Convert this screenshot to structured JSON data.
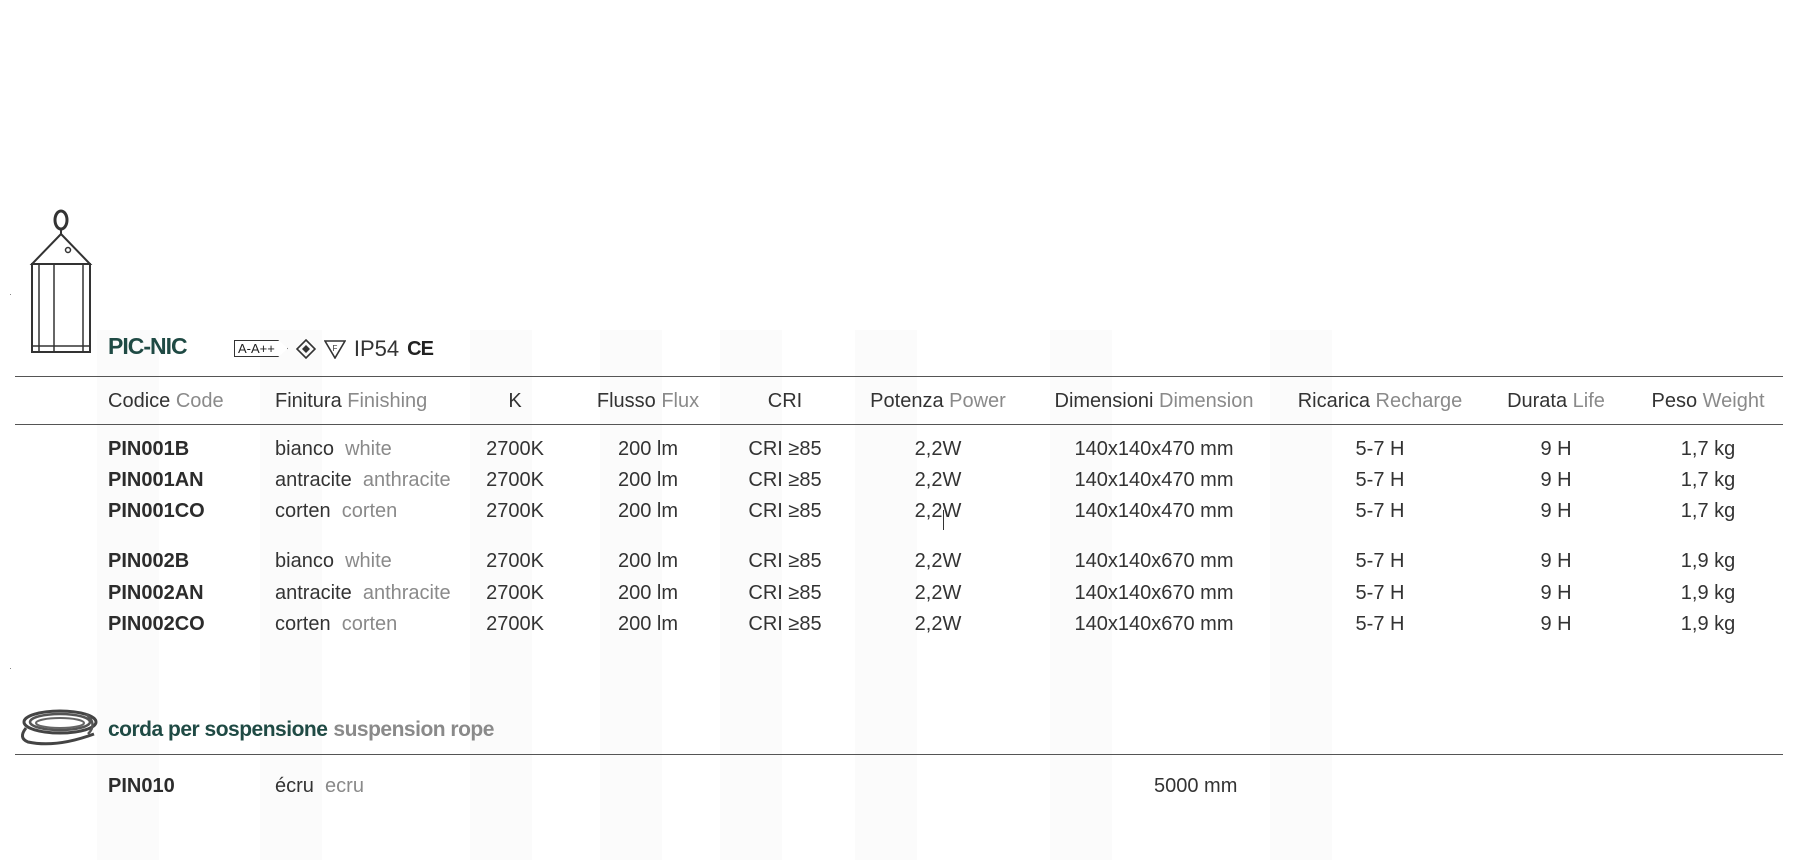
{
  "product": {
    "name": "PIC-NIC",
    "energy_class": "A-A++",
    "ip_rating": "IP54",
    "ce_mark": "CE"
  },
  "table": {
    "headers": [
      {
        "it": "Codice",
        "en": "Code"
      },
      {
        "it": "Finitura",
        "en": "Finishing"
      },
      {
        "it": "K",
        "en": ""
      },
      {
        "it": "Flusso",
        "en": "Flux"
      },
      {
        "it": "CRI",
        "en": ""
      },
      {
        "it": "Potenza",
        "en": "Power"
      },
      {
        "it": "Dimensioni",
        "en": "Dimension"
      },
      {
        "it": "Ricarica",
        "en": "Recharge"
      },
      {
        "it": "Durata",
        "en": "Life"
      },
      {
        "it": "Peso",
        "en": "Weight"
      }
    ],
    "rows": [
      {
        "code": "PIN001B",
        "finish_it": "bianco",
        "finish_en": "white",
        "k": "2700K",
        "flux": "200 lm",
        "cri": "CRI ≥85",
        "power": "2,2W",
        "dim": "140x140x470 mm",
        "recharge": "5-7 H",
        "life": "9 H",
        "weight": "1,7 kg"
      },
      {
        "code": "PIN001AN",
        "finish_it": "antracite",
        "finish_en": "anthracite",
        "k": "2700K",
        "flux": "200 lm",
        "cri": "CRI ≥85",
        "power": "2,2W",
        "dim": "140x140x470 mm",
        "recharge": "5-7 H",
        "life": "9 H",
        "weight": "1,7 kg"
      },
      {
        "code": "PIN001CO",
        "finish_it": "corten",
        "finish_en": "corten",
        "k": "2700K",
        "flux": "200 lm",
        "cri": "CRI ≥85",
        "power": "2,2W",
        "dim": "140x140x470 mm",
        "recharge": "5-7 H",
        "life": "9 H",
        "weight": "1,7 kg"
      },
      {
        "code": "PIN002B",
        "finish_it": "bianco",
        "finish_en": "white",
        "k": "2700K",
        "flux": "200 lm",
        "cri": "CRI ≥85",
        "power": "2,2W",
        "dim": "140x140x670 mm",
        "recharge": "5-7 H",
        "life": "9 H",
        "weight": "1,9 kg"
      },
      {
        "code": "PIN002AN",
        "finish_it": "antracite",
        "finish_en": "anthracite",
        "k": "2700K",
        "flux": "200 lm",
        "cri": "CRI ≥85",
        "power": "2,2W",
        "dim": "140x140x670 mm",
        "recharge": "5-7 H",
        "life": "9 H",
        "weight": "1,9 kg"
      },
      {
        "code": "PIN002CO",
        "finish_it": "corten",
        "finish_en": "corten",
        "k": "2700K",
        "flux": "200 lm",
        "cri": "CRI ≥85",
        "power": "2,2W",
        "dim": "140x140x670 mm",
        "recharge": "5-7 H",
        "life": "9 H",
        "weight": "1,9 kg"
      }
    ]
  },
  "accessory": {
    "title_it": "corda per sospensione",
    "title_en": "suspension rope",
    "code": "PIN010",
    "finish_it": "écru",
    "finish_en": "ecru",
    "dim": "5000 mm"
  },
  "icons": {
    "product": "lantern-icon",
    "accessory": "rope-icon",
    "certifications": [
      "energy-class-icon",
      "class-ii-icon",
      "f-mark-icon"
    ]
  },
  "colors": {
    "title": "#1f4a44",
    "secondary_text": "#8a8a8a"
  }
}
